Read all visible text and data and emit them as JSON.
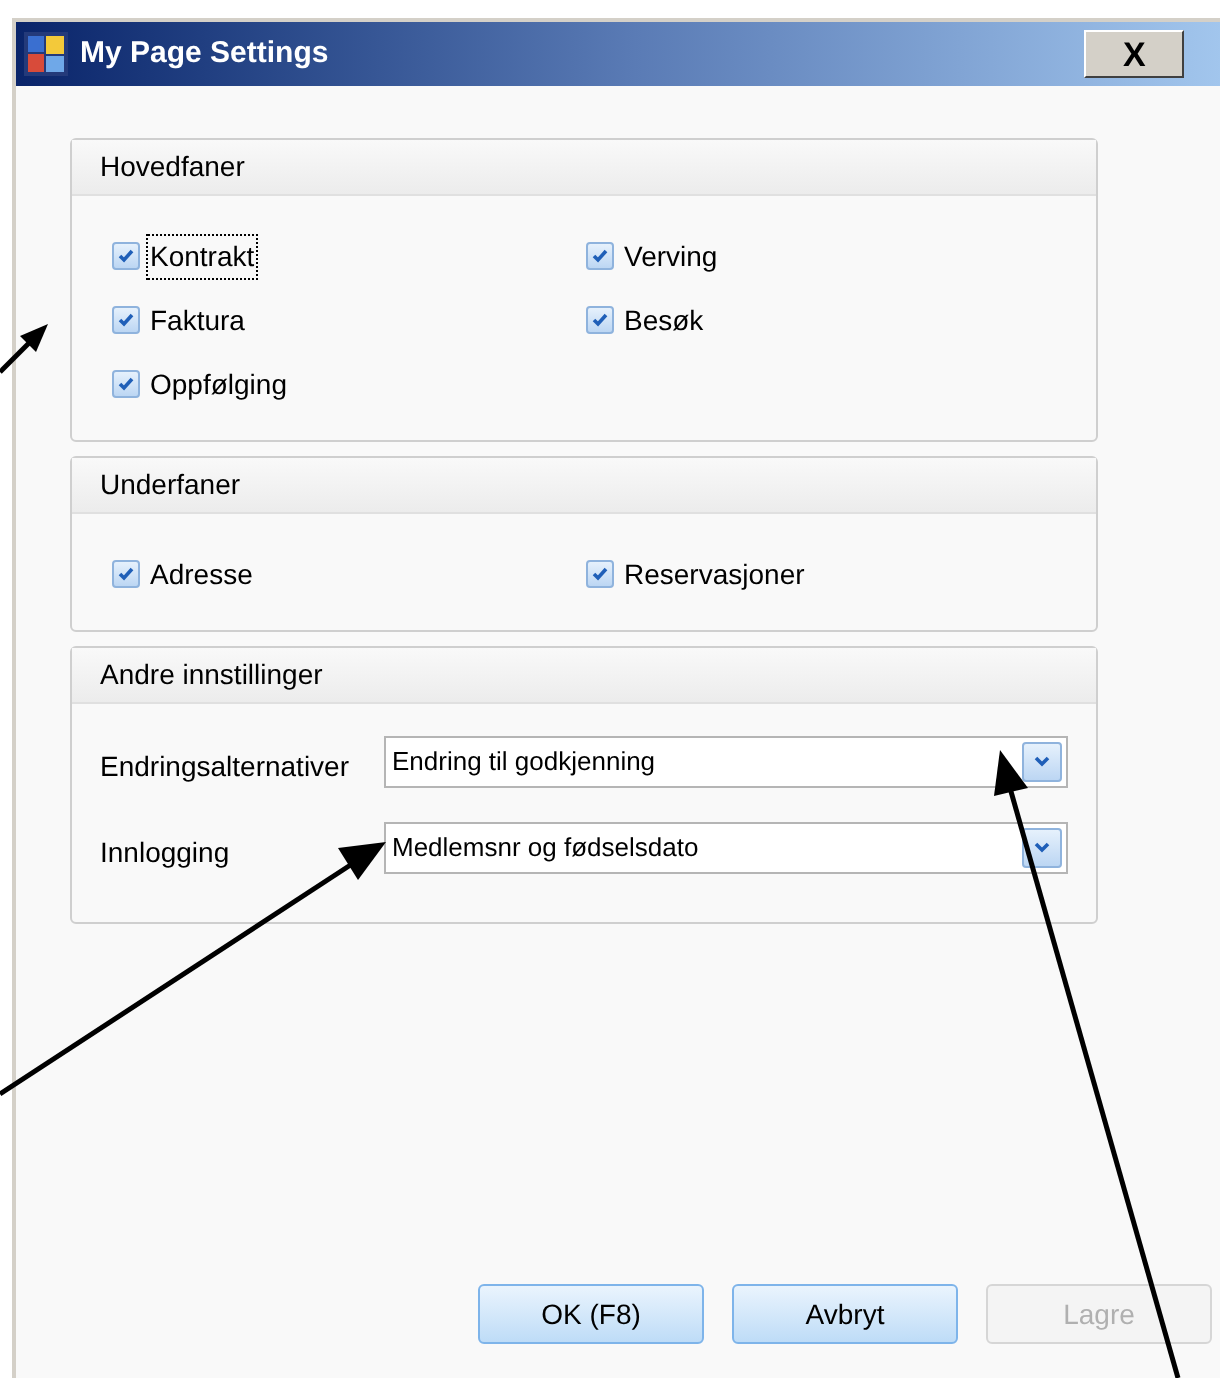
{
  "window": {
    "title": "My Page Settings",
    "close": "X"
  },
  "groups": [
    {
      "kind": "checkboxes",
      "title": "Hovedfaner",
      "items": [
        {
          "label": "Kontrakt",
          "checked": true,
          "focused": true
        },
        {
          "label": "Verving",
          "checked": true,
          "focused": false
        },
        {
          "label": "Faktura",
          "checked": true,
          "focused": false
        },
        {
          "label": "Besøk",
          "checked": true,
          "focused": false
        },
        {
          "label": "Oppfølging",
          "checked": true,
          "focused": false
        }
      ]
    },
    {
      "kind": "checkboxes",
      "title": "Underfaner",
      "items": [
        {
          "label": "Adresse",
          "checked": true,
          "focused": false
        },
        {
          "label": "Reservasjoner",
          "checked": true,
          "focused": false
        }
      ]
    },
    {
      "kind": "fields",
      "title": "Andre innstillinger",
      "fields": [
        {
          "label": "Endringsalternativer",
          "value": "Endring til godkjenning"
        },
        {
          "label": "Innlogging",
          "value": "Medlemsnr og fødselsdato"
        }
      ]
    }
  ],
  "buttons": [
    {
      "label": "OK (F8)",
      "disabled": false
    },
    {
      "label": "Avbryt",
      "disabled": false
    },
    {
      "label": "Lagre",
      "disabled": true
    }
  ]
}
